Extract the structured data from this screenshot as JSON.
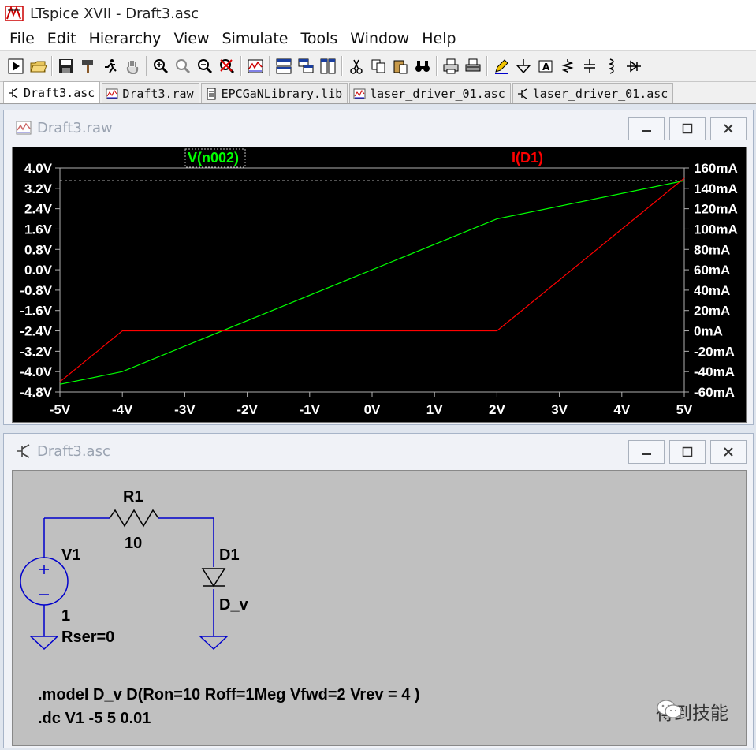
{
  "app": {
    "title": "LTspice XVII - Draft3.asc"
  },
  "menu": [
    "File",
    "Edit",
    "Hierarchy",
    "View",
    "Simulate",
    "Tools",
    "Window",
    "Help"
  ],
  "toolbar_icons": [
    "open-schematic-icon",
    "open-folder-icon",
    "save-icon",
    "hammer-icon",
    "run-icon",
    "pan-hand-icon",
    "zoom-in-icon",
    "zoom-fit-icon",
    "zoom-out-icon",
    "zoom-cancel-icon",
    "waveform-icon",
    "tile-horizontal-icon",
    "cascade-icon",
    "tile-vertical-icon",
    "cut-icon",
    "copy-icon",
    "paste-icon",
    "find-icon",
    "print-icon",
    "print-setup-icon",
    "pencil-icon",
    "ground-icon",
    "label-icon",
    "resistor-icon",
    "capacitor-icon",
    "inductor-icon",
    "diode-icon"
  ],
  "tabs": [
    {
      "label": "Draft3.asc",
      "icon": "schematic-icon"
    },
    {
      "label": "Draft3.raw",
      "icon": "waveform-icon"
    },
    {
      "label": "EPCGaNLibrary.lib",
      "icon": "document-icon"
    },
    {
      "label": "laser_driver_01.asc",
      "icon": "waveform-icon"
    },
    {
      "label": "laser_driver_01.asc",
      "icon": "schematic-icon"
    }
  ],
  "waveform_window": {
    "title": "Draft3.raw"
  },
  "schematic_window": {
    "title": "Draft3.asc"
  },
  "colors": {
    "trace_v": "#00ff00",
    "trace_i": "#ff0000",
    "axis": "#b0b0b0",
    "label_v": "#00ff00",
    "label_i": "#ff0000",
    "wire": "#0000cc",
    "schematic_bg": "#c0c0c0"
  },
  "chart_data": {
    "type": "line",
    "x": [
      -5,
      -4,
      2,
      5
    ],
    "xlabel": "",
    "ylabel": "",
    "xlim": [
      -5,
      5
    ],
    "ylim_left": [
      -4.8,
      4.0
    ],
    "ylim_right": [
      -60,
      160
    ],
    "x_ticks": [
      "-5V",
      "-4V",
      "-3V",
      "-2V",
      "-1V",
      "0V",
      "1V",
      "2V",
      "3V",
      "4V",
      "5V"
    ],
    "y_ticks_left": [
      "4.0V",
      "3.2V",
      "2.4V",
      "1.6V",
      "0.8V",
      "0.0V",
      "-0.8V",
      "-1.6V",
      "-2.4V",
      "-3.2V",
      "-4.0V",
      "-4.8V"
    ],
    "y_ticks_right": [
      "160mA",
      "140mA",
      "120mA",
      "100mA",
      "80mA",
      "60mA",
      "40mA",
      "20mA",
      "0mA",
      "-20mA",
      "-40mA",
      "-60mA"
    ],
    "series": [
      {
        "name": "V(n002)",
        "axis": "left",
        "values": [
          -4.5,
          -4.0,
          2.0,
          3.5
        ]
      },
      {
        "name": "I(D1)",
        "axis": "right",
        "values": [
          -50,
          0,
          0,
          150
        ]
      }
    ],
    "cursor_line_value": 3.5
  },
  "schematic": {
    "r1_name": "R1",
    "r1_value": "10",
    "v1_name": "V1",
    "v1_value": "1",
    "v1_rser": "Rser=0",
    "d1_name": "D1",
    "d1_model": "D_v",
    "directive_model": ".model D_v D(Ron=10 Roff=1Meg Vfwd=2 Vrev = 4 )",
    "directive_dc": ".dc V1 -5 5 0.01"
  },
  "watermark": {
    "text": "得到技能"
  }
}
